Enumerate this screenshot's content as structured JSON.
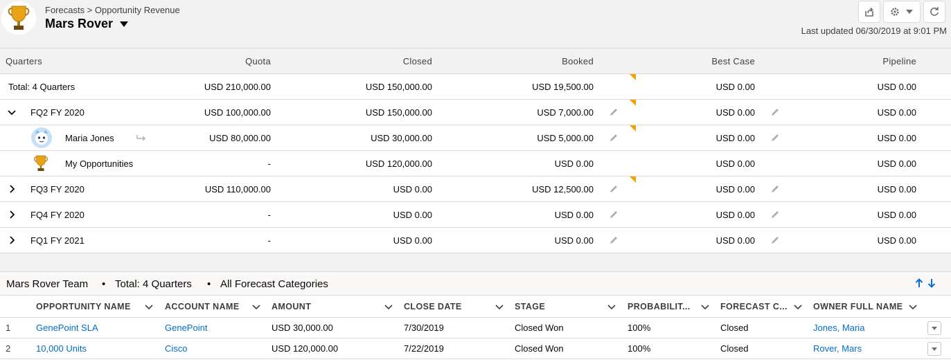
{
  "header": {
    "breadcrumb": "Forecasts > Opportunity Revenue",
    "title": "Mars Rover",
    "last_updated": "Last updated 06/30/2019 at 9:01 PM",
    "icons": {
      "logo": "trophy-icon",
      "share": "share-icon",
      "settings": "gear-icon",
      "refresh": "refresh-icon"
    }
  },
  "forecast": {
    "columns": [
      "Quarters",
      "Quota",
      "Closed",
      "Booked",
      "Best Case",
      "Pipeline"
    ],
    "rows": [
      {
        "label": "Total: 4 Quarters",
        "quota": "USD 210,000.00",
        "closed": "USD 150,000.00",
        "booked": "USD 19,500.00",
        "best_case": "USD 0.00",
        "pipeline": "USD 0.00"
      },
      {
        "label": "FQ2 FY 2020",
        "quota": "USD 100,000.00",
        "closed": "USD 150,000.00",
        "booked": "USD 7,000.00",
        "best_case": "USD 0.00",
        "pipeline": "USD 0.00"
      },
      {
        "label": "Maria Jones",
        "quota": "USD 80,000.00",
        "closed": "USD 30,000.00",
        "booked": "USD 5,000.00",
        "best_case": "USD 0.00",
        "pipeline": "USD 0.00"
      },
      {
        "label": "My Opportunities",
        "quota": "-",
        "closed": "USD 120,000.00",
        "booked": "USD 0.00",
        "best_case": "USD 0.00",
        "pipeline": "USD 0.00"
      },
      {
        "label": "FQ3 FY 2020",
        "quota": "USD 110,000.00",
        "closed": "USD 0.00",
        "booked": "USD 12,500.00",
        "best_case": "USD 0.00",
        "pipeline": "USD 0.00"
      },
      {
        "label": "FQ4 FY 2020",
        "quota": "-",
        "closed": "USD 0.00",
        "booked": "USD 0.00",
        "best_case": "USD 0.00",
        "pipeline": "USD 0.00"
      },
      {
        "label": "FQ1 FY 2021",
        "quota": "-",
        "closed": "USD 0.00",
        "booked": "USD 0.00",
        "best_case": "USD 0.00",
        "pipeline": "USD 0.00"
      }
    ]
  },
  "opportunities": {
    "team": "Mars Rover Team",
    "scope": "Total: 4 Quarters",
    "categories": "All Forecast Categories",
    "separator": "•",
    "columns": [
      "OPPORTUNITY NAME",
      "ACCOUNT NAME",
      "AMOUNT",
      "CLOSE DATE",
      "STAGE",
      "PROBABILIT...",
      "FORECAST C...",
      "OWNER FULL NAME"
    ],
    "rows": [
      {
        "num": "1",
        "name": "GenePoint SLA",
        "account": "GenePoint",
        "amount": "USD 30,000.00",
        "close_date": "7/30/2019",
        "stage": "Closed Won",
        "probability": "100%",
        "forecast": "Closed",
        "owner": "Jones, Maria"
      },
      {
        "num": "2",
        "name": "10,000 Units",
        "account": "Cisco",
        "amount": "USD 120,000.00",
        "close_date": "7/22/2019",
        "stage": "Closed Won",
        "probability": "100%",
        "forecast": "Closed",
        "owner": "Rover, Mars"
      }
    ]
  },
  "colors": {
    "link": "#006dcc",
    "flag": "#f4a100",
    "header_bg": "#f3f2f2"
  }
}
